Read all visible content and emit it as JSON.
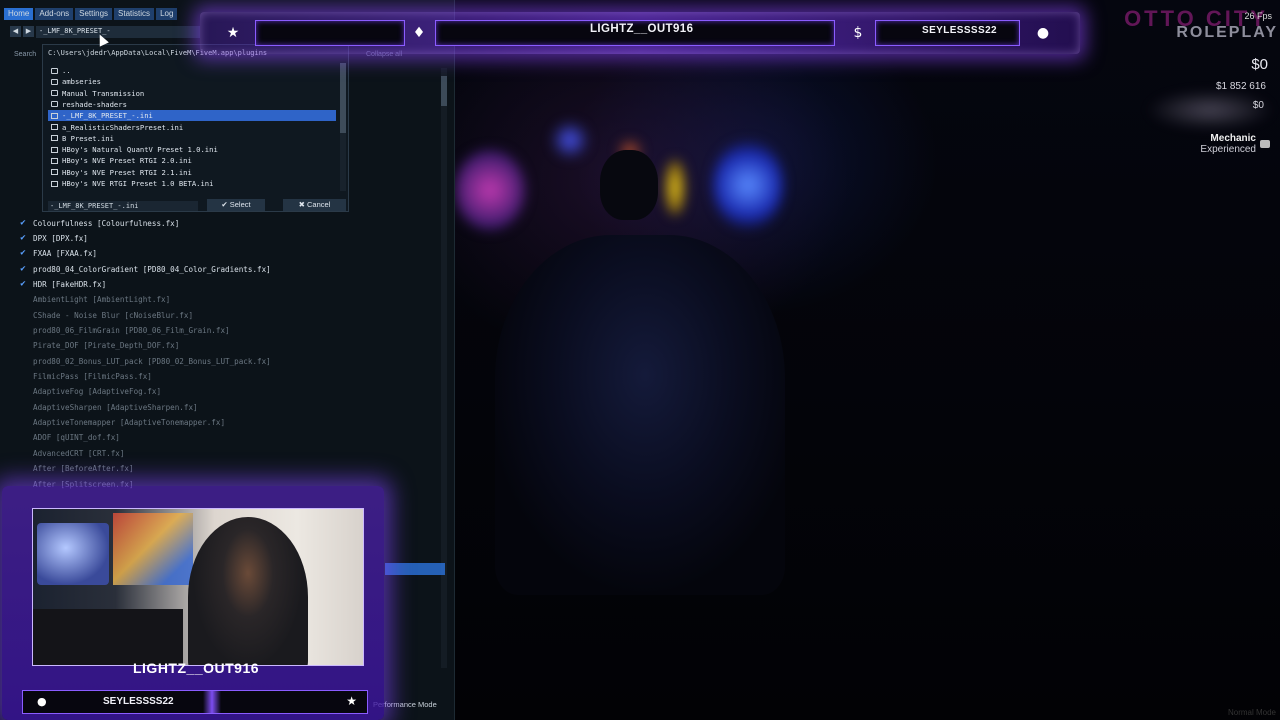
{
  "reshade": {
    "menu": [
      "Home",
      "Add-ons",
      "Settings",
      "Statistics",
      "Log"
    ],
    "preset_name": "-_LMF_8K_PRESET_-",
    "search_label": "Search",
    "collapse_label": "Collapse all",
    "effects": [
      {
        "label": "Colourfulness [Colourfulness.fx]",
        "checked": true
      },
      {
        "label": "DPX [DPX.fx]",
        "checked": true
      },
      {
        "label": "FXAA [FXAA.fx]",
        "checked": true
      },
      {
        "label": "prod80_04_ColorGradient [PD80_04_Color_Gradients.fx]",
        "checked": true
      },
      {
        "label": "HDR [FakeHDR.fx]",
        "checked": true
      },
      {
        "label": "AmbientLight [AmbientLight.fx]",
        "checked": false
      },
      {
        "label": "CShade - Noise Blur [cNoiseBlur.fx]",
        "checked": false
      },
      {
        "label": "prod80_06_FilmGrain [PD80_06_Film_Grain.fx]",
        "checked": false
      },
      {
        "label": "Pirate_DOF [Pirate_Depth_DOF.fx]",
        "checked": false
      },
      {
        "label": "prod80_02_Bonus_LUT_pack [PD80_02_Bonus_LUT_pack.fx]",
        "checked": false
      },
      {
        "label": "FilmicPass [FilmicPass.fx]",
        "checked": false
      },
      {
        "label": "AdaptiveFog [AdaptiveFog.fx]",
        "checked": false
      },
      {
        "label": "AdaptiveSharpen [AdaptiveSharpen.fx]",
        "checked": false
      },
      {
        "label": "AdaptiveTonemapper [AdaptiveTonemapper.fx]",
        "checked": false
      },
      {
        "label": "ADOF [qUINT_dof.fx]",
        "checked": false
      },
      {
        "label": "AdvancedCRT [CRT.fx]",
        "checked": false
      },
      {
        "label": "After [BeforeAfter.fx]",
        "checked": false
      },
      {
        "label": "After [Splitscreen.fx]",
        "checked": false
      }
    ],
    "performance_mode_label": "Performance Mode"
  },
  "file_browser": {
    "path": "C:\\Users\\jdedr\\AppData\\Local\\FiveM\\FiveM.app\\plugins",
    "items": [
      {
        "name": "..",
        "type": "folder"
      },
      {
        "name": "ambseries",
        "type": "folder"
      },
      {
        "name": "Manual Transmission",
        "type": "folder"
      },
      {
        "name": "reshade-shaders",
        "type": "folder"
      },
      {
        "name": "-_LMF_8K_PRESET_-.ini",
        "type": "file",
        "selected": true
      },
      {
        "name": "a_RealisticShadersPreset.ini",
        "type": "file"
      },
      {
        "name": "B Preset.ini",
        "type": "file"
      },
      {
        "name": "HBoy's Natural QuantV Preset 1.0.ini",
        "type": "file"
      },
      {
        "name": "HBoy's NVE Preset RTGI 2.0.ini",
        "type": "file"
      },
      {
        "name": "HBoy's NVE Preset RTGI 2.1.ini",
        "type": "file"
      },
      {
        "name": "HBoy's NVE RTGI Preset 1.0 BETA.ini",
        "type": "file"
      }
    ],
    "filename": "-_LMF_8K_PRESET_-.ini",
    "select_label": "Select",
    "cancel_label": "Cancel"
  },
  "hud": {
    "server_logo_line1": "OTTO CITY",
    "server_logo_line2": "ROLEPLAY",
    "fps": "26 Fps",
    "cash": "$0",
    "bank": "$1 852 616",
    "dirty_money": "$0",
    "job_name": "Mechanic",
    "job_grade": "Experienced",
    "watermark": "Normal Mode"
  },
  "stream_overlay": {
    "top_left_name": "LIGHTZ__OUT916",
    "top_right_name": "SEYLESSSS22",
    "webcam_name": "LIGHTZ__OUT916",
    "webcam_bottom_name": "SEYLESSSS22",
    "accent_color": "#8a5cff"
  }
}
